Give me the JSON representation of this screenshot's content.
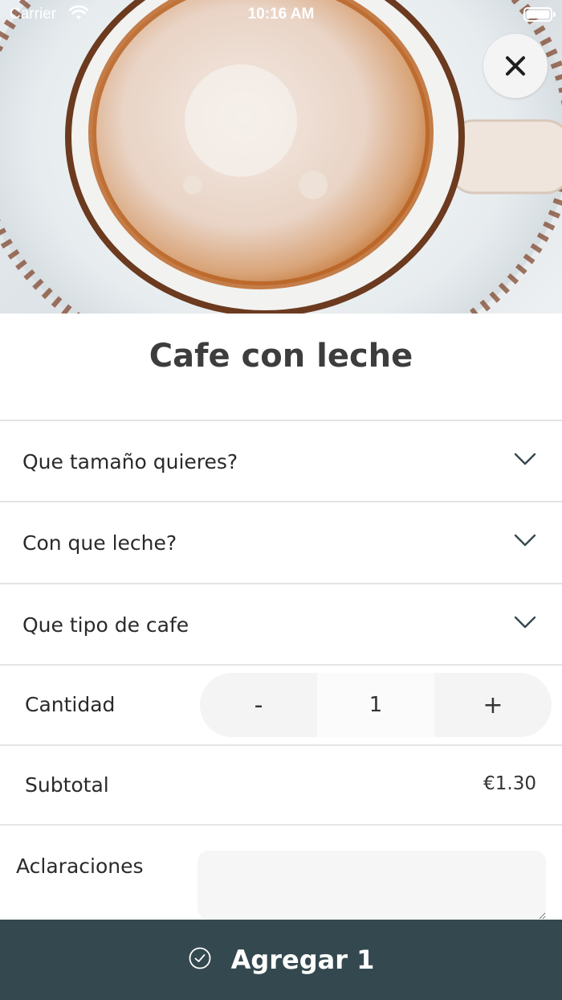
{
  "status_bar": {
    "carrier": "Carrier",
    "time": "10:16 AM"
  },
  "product": {
    "title": "Cafe con leche",
    "image_icon": "coffee-cup-photo"
  },
  "options": [
    {
      "label": "Que tamaño quieres?"
    },
    {
      "label": "Con que leche?"
    },
    {
      "label": "Que tipo de cafe"
    }
  ],
  "quantity": {
    "label": "Cantidad",
    "minus": "-",
    "value": "1",
    "plus": "+"
  },
  "subtotal": {
    "label": "Subtotal",
    "value": "€1.30"
  },
  "notes": {
    "label": "Aclaraciones",
    "value": ""
  },
  "add_button": {
    "label": "Agregar 1",
    "icon": "check-circle-icon"
  },
  "colors": {
    "primary_dark": "#34494f",
    "chevron": "#34494f"
  }
}
